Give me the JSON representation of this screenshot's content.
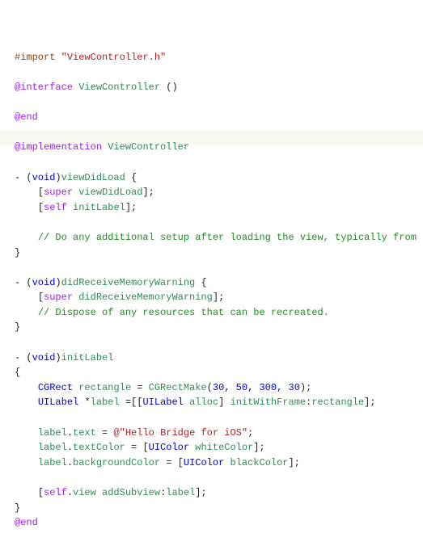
{
  "code": {
    "import_directive": "#import",
    "import_header": "\"ViewController.h\"",
    "interface_kw": "@interface",
    "class_name": "ViewController",
    "parens": "()",
    "end_kw": "@end",
    "implementation_kw": "@implementation",
    "dash": "-",
    "void_type": "void",
    "method_viewDidLoad": "viewDidLoad",
    "method_didReceiveMemoryWarning": "didReceiveMemoryWarning",
    "method_initLabel": "initLabel",
    "super_kw": "super",
    "self_kw": "self",
    "msg_viewDidLoad": "viewDidLoad",
    "msg_initLabel": "initLabel",
    "msg_didReceiveMemoryWarning": "didReceiveMemoryWarning",
    "comment_setup": "// Do any additional setup after loading the view, typically from",
    "comment_dispose": "// Dispose of any resources that can be recreated.",
    "type_CGRect": "CGRect",
    "var_rectangle": "rectangle",
    "fn_CGRectMake": "CGRectMake",
    "rect_args": "30, 50, 300, 30",
    "type_UILabel": "UILabel",
    "var_label": "label",
    "msg_alloc": "alloc",
    "msg_initWithFrame": "initWithFrame",
    "arg_rectangle": "rectangle",
    "prop_text": "text",
    "objc_string": "@\"Hello Bridge for iOS\"",
    "prop_textColor": "textColor",
    "type_UIColor": "UIColor",
    "msg_whiteColor": "whiteColor",
    "msg_blackColor": "blackColor",
    "prop_backgroundColor": "backgroundColor",
    "prop_view": "view",
    "msg_addSubview": "addSubview",
    "arg_label": "label"
  }
}
